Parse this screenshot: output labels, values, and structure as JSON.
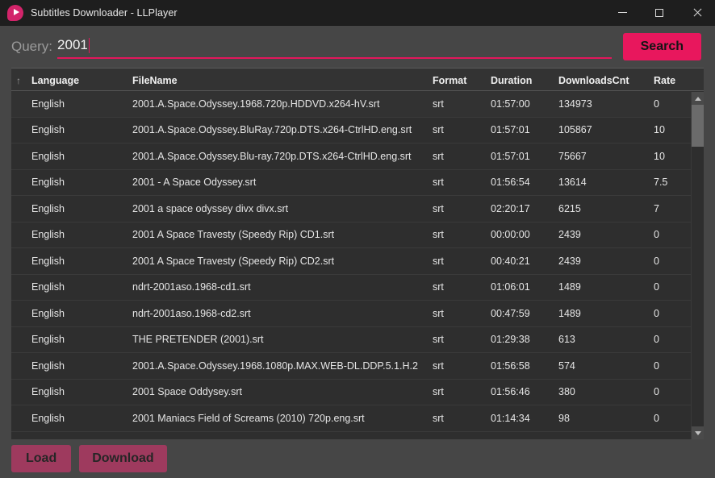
{
  "window": {
    "title": "Subtitles Downloader - LLPlayer",
    "logo_icon": "play-bubble-icon",
    "controls": {
      "minimize": "minimize-icon",
      "maximize": "maximize-icon",
      "close": "close-icon"
    }
  },
  "search": {
    "label": "Query:",
    "value": "2001",
    "placeholder": "",
    "button_label": "Search",
    "accent_color": "#e8175d"
  },
  "table": {
    "sort_indicator": "↑",
    "sort_column": "Language",
    "columns": [
      "Language",
      "FileName",
      "Format",
      "Duration",
      "DownloadsCnt",
      "Rate"
    ],
    "rows": [
      {
        "language": "English",
        "filename": "2001.A.Space.Odyssey.1968.720p.HDDVD.x264-hV.srt",
        "format": "srt",
        "duration": "01:57:00",
        "downloads": "134973",
        "rate": "0"
      },
      {
        "language": "English",
        "filename": "2001.A.Space.Odyssey.BluRay.720p.DTS.x264-CtrlHD.eng.srt",
        "format": "srt",
        "duration": "01:57:01",
        "downloads": "105867",
        "rate": "10"
      },
      {
        "language": "English",
        "filename": "2001.A.Space.Odyssey.Blu-ray.720p.DTS.x264-CtrlHD.eng.srt",
        "format": "srt",
        "duration": "01:57:01",
        "downloads": "75667",
        "rate": "10"
      },
      {
        "language": "English",
        "filename": "2001 - A Space Odyssey.srt",
        "format": "srt",
        "duration": "01:56:54",
        "downloads": "13614",
        "rate": "7.5"
      },
      {
        "language": "English",
        "filename": "2001 a space odyssey divx divx.srt",
        "format": "srt",
        "duration": "02:20:17",
        "downloads": "6215",
        "rate": "7"
      },
      {
        "language": "English",
        "filename": "2001 A Space Travesty (Speedy Rip) CD1.srt",
        "format": "srt",
        "duration": "00:00:00",
        "downloads": "2439",
        "rate": "0"
      },
      {
        "language": "English",
        "filename": "2001 A Space Travesty (Speedy Rip) CD2.srt",
        "format": "srt",
        "duration": "00:40:21",
        "downloads": "2439",
        "rate": "0"
      },
      {
        "language": "English",
        "filename": "ndrt-2001aso.1968-cd1.srt",
        "format": "srt",
        "duration": "01:06:01",
        "downloads": "1489",
        "rate": "0"
      },
      {
        "language": "English",
        "filename": "ndrt-2001aso.1968-cd2.srt",
        "format": "srt",
        "duration": "00:47:59",
        "downloads": "1489",
        "rate": "0"
      },
      {
        "language": "English",
        "filename": "THE PRETENDER (2001).srt",
        "format": "srt",
        "duration": "01:29:38",
        "downloads": "613",
        "rate": "0"
      },
      {
        "language": "English",
        "filename": "2001.A.Space.Odyssey.1968.1080p.MAX.WEB-DL.DDP.5.1.H.2",
        "format": "srt",
        "duration": "01:56:58",
        "downloads": "574",
        "rate": "0"
      },
      {
        "language": "English",
        "filename": "2001 Space Oddysey.srt",
        "format": "srt",
        "duration": "01:56:46",
        "downloads": "380",
        "rate": "0"
      },
      {
        "language": "English",
        "filename": "2001 Maniacs Field of Screams (2010) 720p.eng.srt",
        "format": "srt",
        "duration": "01:14:34",
        "downloads": "98",
        "rate": "0"
      }
    ]
  },
  "scrollbar": {
    "up_icon": "scroll-up-arrow-icon",
    "down_icon": "scroll-down-arrow-icon"
  },
  "footer": {
    "load_label": "Load",
    "download_label": "Download",
    "button_color": "#9e3a5e"
  }
}
